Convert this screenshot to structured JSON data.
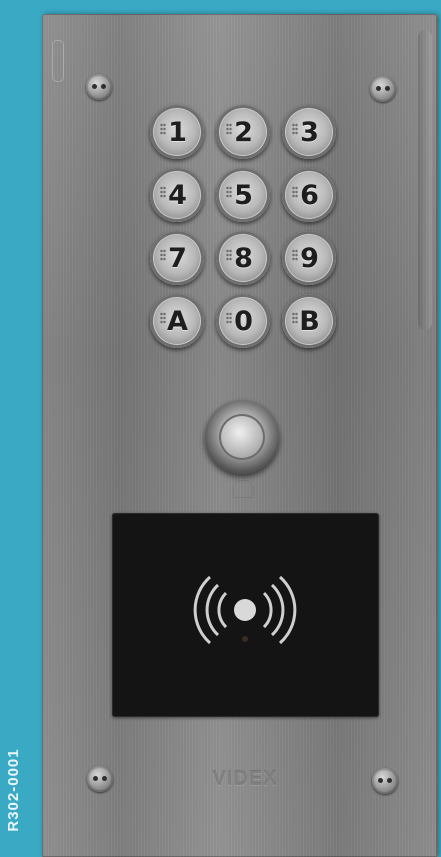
{
  "product_code": "R302-0001",
  "colors": {
    "background": "#3aa9c4",
    "panel": "#858585",
    "reader": "#141414"
  },
  "keypad": {
    "keys": [
      "1",
      "2",
      "3",
      "4",
      "5",
      "6",
      "7",
      "8",
      "9",
      "A",
      "0",
      "B"
    ]
  },
  "call_button": {
    "icon": "bell-icon"
  },
  "rfid": {
    "icon": "contactless-wave-icon"
  },
  "brand": "VIDEX"
}
